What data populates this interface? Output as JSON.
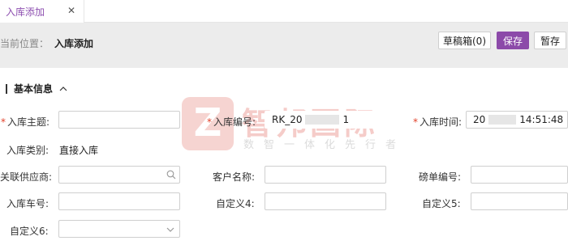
{
  "tabs": [
    {
      "label": "入库添加"
    }
  ],
  "header": {
    "breadcrumb_prefix": "当前位置：",
    "page_title": "入库添加",
    "buttons": {
      "draft": "草稿箱(0)",
      "save": "保存",
      "stash": "暂存"
    }
  },
  "section": {
    "title": "基本信息"
  },
  "form": {
    "inbound_subject": {
      "label": "入库主题:",
      "value": ""
    },
    "inbound_no": {
      "label": "入库编号:",
      "value_prefix": "RK_20",
      "value_suffix": "1"
    },
    "inbound_time": {
      "label": "入库时间:",
      "value_prefix": "20",
      "value_suffix": "14:51:48"
    },
    "inbound_type": {
      "label": "入库类别:",
      "value": "直接入库"
    },
    "supplier": {
      "label": "关联供应商:",
      "value": ""
    },
    "customer_name": {
      "label": "客户名称:",
      "value": ""
    },
    "weigh_no": {
      "label": "磅单编号:",
      "value": ""
    },
    "vehicle_no": {
      "label": "入库车号:",
      "value": ""
    },
    "custom4": {
      "label": "自定义4:",
      "value": ""
    },
    "custom5": {
      "label": "自定义5:",
      "value": ""
    },
    "custom6": {
      "label": "自定义6:",
      "value": ""
    }
  },
  "watermark": {
    "logo_letter": "Z",
    "title": "智邦国际",
    "subtitle": "数智一体化先行者"
  },
  "colors": {
    "accent": "#8c4aa9",
    "required": "#e2412a",
    "header_bg": "#ececec"
  }
}
